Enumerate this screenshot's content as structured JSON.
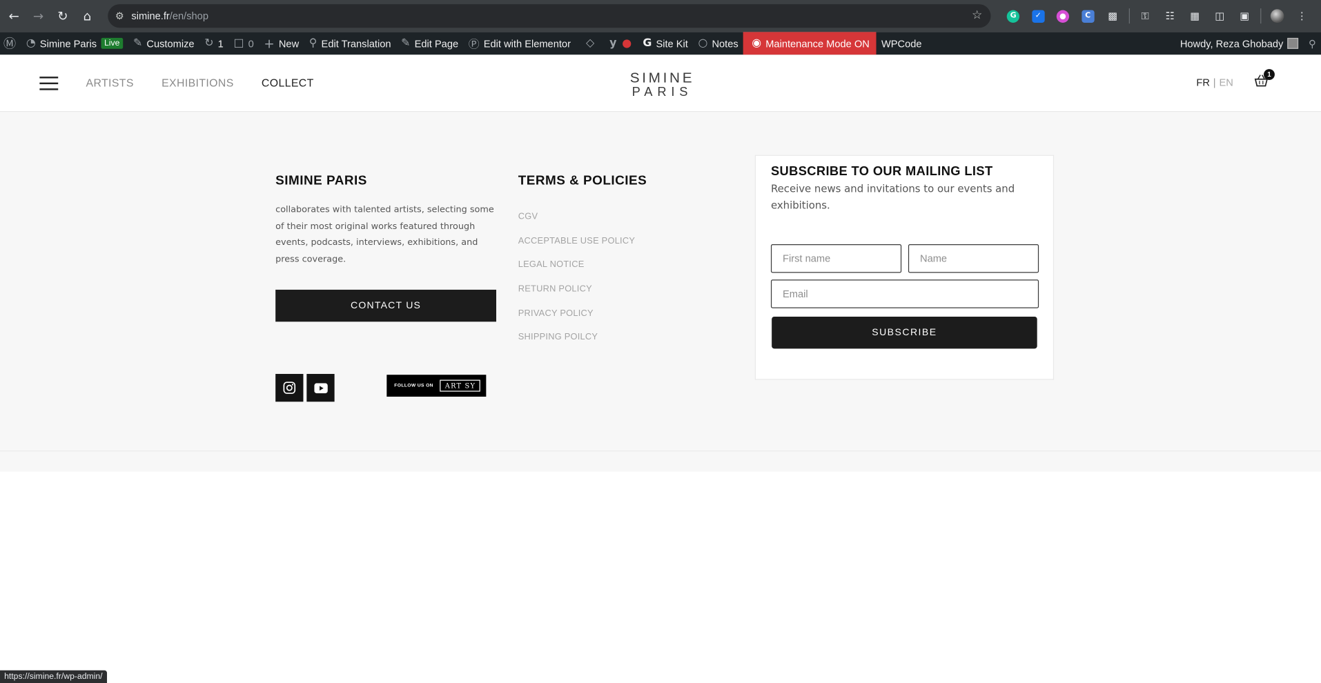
{
  "browser": {
    "url_host": "simine.fr",
    "url_path": "/en/shop"
  },
  "adminbar": {
    "site_name": "Simine Paris",
    "live": "Live",
    "customize": "Customize",
    "updates_count": "1",
    "comments_count": "0",
    "new": "New",
    "edit_translation": "Edit Translation",
    "edit_page": "Edit Page",
    "edit_elementor": "Edit with Elementor",
    "site_kit": "Site Kit",
    "notes": "Notes",
    "maintenance": "Maintenance Mode ON",
    "wpcode": "WPCode",
    "howdy": "Howdy, Reza Ghobady"
  },
  "header": {
    "nav": [
      "ARTISTS",
      "EXHIBITIONS",
      "COLLECT"
    ],
    "logo_line1": "SIMINE",
    "logo_line2": "PARIS",
    "lang_fr": "FR",
    "lang_sep": "|",
    "lang_en": "EN",
    "cart_count": "1"
  },
  "footer": {
    "about_title": "SIMINE PARIS",
    "about_text": "collaborates with talented artists, selecting some of their most original works featured through events, podcasts, interviews, exhibitions, and press coverage.",
    "contact_label": "CONTACT US",
    "artsy_follow": "FOLLOW US ON",
    "artsy_brand": "ART SY",
    "terms_title": "TERMS & POLICIES",
    "policies": [
      "CGV",
      "ACCEPTABLE USE POLICY",
      "LEGAL NOTICE",
      "RETURN POLICY",
      "PRIVACY POLICY",
      "SHIPPING POILCY"
    ]
  },
  "subscribe": {
    "title": "SUBSCRIBE TO OUR MAILING LIST",
    "desc": "Receive news and invitations to our events and exhibitions.",
    "first_name_placeholder": "First name",
    "name_placeholder": "Name",
    "email_placeholder": "Email",
    "button": "SUBSCRIBE"
  },
  "status_url": "https://simine.fr/wp-admin/"
}
